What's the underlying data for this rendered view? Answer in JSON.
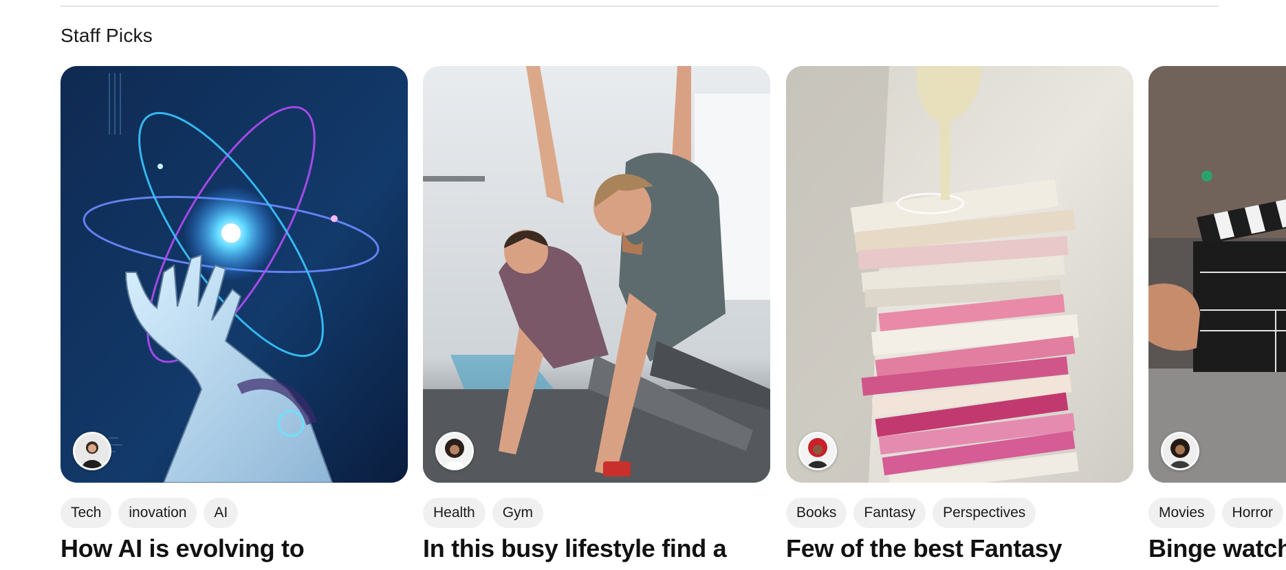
{
  "section": {
    "title": "Staff Picks"
  },
  "colors": {
    "tag_bg": "#f0f0f0",
    "divider": "#e4e4e4",
    "text": "#111111"
  },
  "cards": [
    {
      "image": "robotic-hand-atom-illustration",
      "avatar": "author-avatar",
      "tags": [
        "Tech",
        "inovation",
        "AI"
      ],
      "title": "How AI is evolving to"
    },
    {
      "image": "gym-side-plank-workout-photo",
      "avatar": "author-avatar",
      "tags": [
        "Health",
        "Gym"
      ],
      "title": "In this busy lifestyle find a"
    },
    {
      "image": "stacked-books-wine-glass-photo",
      "avatar": "author-avatar",
      "tags": [
        "Books",
        "Fantasy",
        "Perspectives"
      ],
      "title": "Few of the best Fantasy"
    },
    {
      "image": "film-clapperboard-photo",
      "avatar": "author-avatar",
      "tags": [
        "Movies",
        "Horror"
      ],
      "title": "Binge watch"
    }
  ]
}
